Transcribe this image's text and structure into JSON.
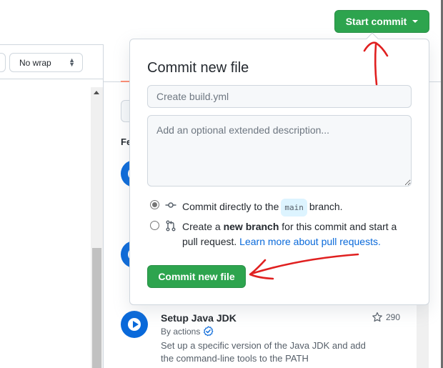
{
  "header": {
    "start_commit_label": "Start commit"
  },
  "editor": {
    "wrap_select_value": "No wrap"
  },
  "side_panel": {
    "heading_partial": "Fe",
    "featured_action": {
      "title": "Setup Java JDK",
      "by": "By actions",
      "description": "Set up a specific version of the Java JDK and add the command-line tools to the PATH",
      "stars": "290"
    }
  },
  "commit_popover": {
    "title": "Commit new file",
    "summary_placeholder": "Create build.yml",
    "description_placeholder": "Add an optional extended description...",
    "option_direct": {
      "prefix": "Commit directly to the",
      "branch": "main",
      "suffix": "branch.",
      "checked": true
    },
    "option_new_branch": {
      "prefix": "Create a",
      "bold": "new branch",
      "suffix": "for this commit and start a pull request.",
      "link": "Learn more about pull requests.",
      "checked": false
    },
    "commit_button_label": "Commit new file"
  },
  "colors": {
    "primary_green": "#2da44e",
    "link_blue": "#0969da",
    "annotation_red": "#e02020"
  }
}
